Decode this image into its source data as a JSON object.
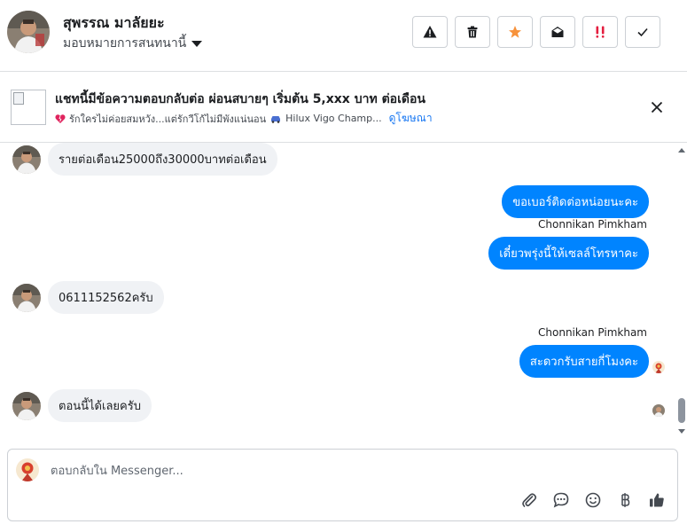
{
  "header": {
    "user_name": "สุพรรณ มาลัยยะ",
    "assign_label": "มอบหมายการสนทนานี้",
    "toolbar": [
      {
        "name": "report-spam-button",
        "icon": "warning-icon"
      },
      {
        "name": "delete-button",
        "icon": "trash-icon"
      },
      {
        "name": "star-button",
        "icon": "star-icon"
      },
      {
        "name": "mark-unread-button",
        "icon": "envelope-open-icon"
      },
      {
        "name": "follow-up-button",
        "icon": "double-exclamation-icon"
      },
      {
        "name": "mark-done-button",
        "icon": "check-icon"
      }
    ]
  },
  "ad": {
    "title": "แชทนี้มีข้อความตอบกลับต่อ ผ่อนสบายๆ เริ่มต้น 5,xxx บาท ต่อเดือน",
    "subtitle_text": "รักใครไม่ค่อยสมหวัง...แต่รักวีโก้ไม่มีพังแน่นอน",
    "subtitle_product": "Hilux Vigo Champ...",
    "view_ad_link": "ดูโฆษณา"
  },
  "messages": {
    "m1": "รายต่อเดือน25000ถึง30000บาทต่อเดือน",
    "m2": "ขอเบอร์ติดต่อหน่อยนะคะ",
    "sender1": "Chonnikan Pimkham",
    "m3": "เดี๋ยวพรุ่งนี้ให้เซลล์โทรหาคะ",
    "m4": "0611152562ครับ",
    "sender2": "Chonnikan Pimkham",
    "m5": "สะดวกรับสายกี่โมงคะ",
    "m6": "ตอนนี้ได้เลยครับ"
  },
  "composer": {
    "placeholder": "ตอบกลับใน Messenger..."
  },
  "colors": {
    "outgoing_bubble": "#0084ff",
    "incoming_bubble": "#f0f2f5",
    "star": "#f7923b",
    "alert_red": "#e41e3f",
    "link": "#1877f2"
  }
}
